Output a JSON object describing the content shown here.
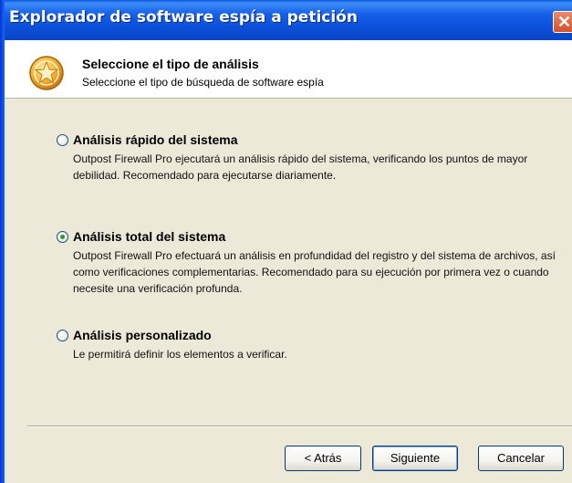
{
  "window": {
    "title": "Explorador de software espía a petición"
  },
  "header": {
    "title": "Seleccione el tipo de análisis",
    "subtitle": "Seleccione el tipo de búsqueda de software espía",
    "icon": "star-shield-icon"
  },
  "options": [
    {
      "label": "Análisis rápido del sistema",
      "description": "Outpost Firewall Pro ejecutará un análisis rápido del sistema, verificando los puntos de mayor debilidad. Recomendado para ejecutarse diariamente.",
      "selected": false
    },
    {
      "label": "Análisis total del sistema",
      "description": "Outpost Firewall Pro efectuará un análisis en profundidad del registro y del sistema de archivos, así como verificaciones complementarias. Recomendado para su ejecución por primera vez o cuando necesite una verificación profunda.",
      "selected": true
    },
    {
      "label": "Análisis personalizado",
      "description": "Le permitirá definir los elementos a verificar.",
      "selected": false
    }
  ],
  "buttons": {
    "back": "< Atrás",
    "next": "Siguiente",
    "cancel": "Cancelar"
  },
  "colors": {
    "titlebar": "#0b4fd8",
    "dialog_bg": "#ece9d8",
    "close": "#d2522a",
    "radio_dot": "#2a9b2a"
  }
}
